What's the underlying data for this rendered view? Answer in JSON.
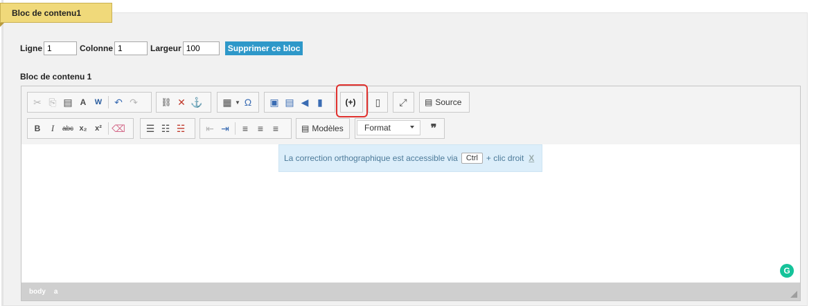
{
  "header": {
    "tab_title": "Bloc de contenu1"
  },
  "fields": {
    "ligne_label": "Ligne",
    "ligne_value": "1",
    "colonne_label": "Colonne",
    "colonne_value": "1",
    "largeur_label": "Largeur",
    "largeur_value": "100",
    "delete_button": "Supprimer ce bloc"
  },
  "content_block_label": "Bloc de contenu 1",
  "toolbar": {
    "row1": [
      {
        "icon": "cut-icon",
        "glyph": "✂"
      },
      {
        "icon": "copy-icon",
        "glyph": "⎘"
      },
      {
        "icon": "paste-icon",
        "glyph": "📋"
      },
      {
        "icon": "paste-text-icon",
        "glyph": "A"
      },
      {
        "icon": "paste-word-icon",
        "glyph": "W"
      },
      {
        "icon": "undo-icon",
        "glyph": "↶"
      },
      {
        "icon": "redo-icon",
        "glyph": "↷"
      },
      {
        "icon": "link-icon",
        "glyph": "🔗"
      },
      {
        "icon": "unlink-icon",
        "glyph": "✕"
      },
      {
        "icon": "anchor-icon",
        "glyph": "⚓"
      },
      {
        "icon": "table-icon",
        "glyph": "▦"
      },
      {
        "icon": "special-char-icon",
        "glyph": "Ω"
      },
      {
        "icon": "image-icon",
        "glyph": "▣"
      },
      {
        "icon": "video-icon",
        "glyph": "▤"
      },
      {
        "icon": "audio-icon",
        "glyph": "◀"
      },
      {
        "icon": "flash-icon",
        "glyph": "▮"
      },
      {
        "icon": "insert-placeholder-icon",
        "glyph": "(+)"
      },
      {
        "icon": "show-blocks-icon",
        "glyph": "▯"
      },
      {
        "icon": "maximize-icon",
        "glyph": "⤢"
      },
      {
        "icon": "source-icon",
        "glyph": "📄"
      }
    ],
    "source_label": "Source",
    "templates_label": "Modèles",
    "format_label": "Format",
    "quote_glyph": "❞"
  },
  "spell_notice": {
    "text_before": "La correction orthographique est accessible via",
    "key": "Ctrl",
    "text_after": "+ clic droit",
    "close": "X"
  },
  "statusbar": {
    "path_body": "body",
    "path_a": "a"
  },
  "grammarly": "G"
}
